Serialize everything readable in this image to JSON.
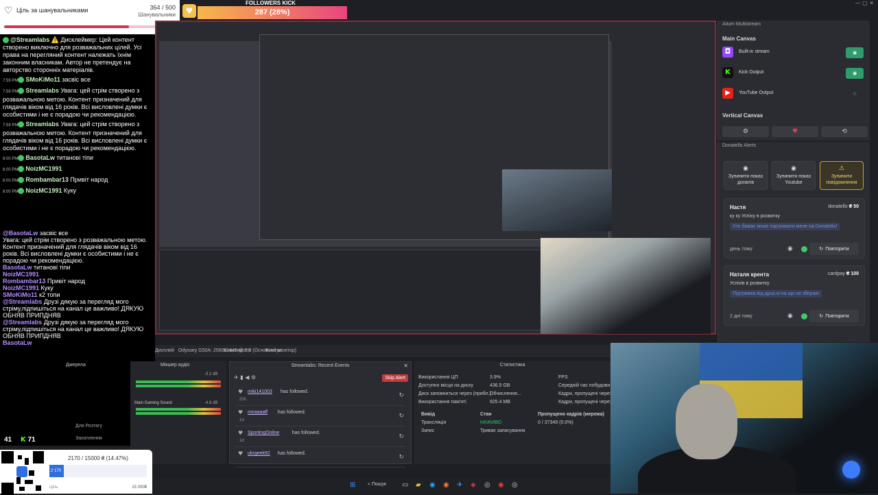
{
  "follower_goal": {
    "title": "Ціль за шанувальниками",
    "count": "364 / 500",
    "subtitle": "Шанувальники",
    "progress": 0.728
  },
  "kick_goal": {
    "label": "FOLLOWERS KICK",
    "value": "287 (28%)",
    "progress": 0.287
  },
  "chat": [
    {
      "time": "",
      "user": "@Streamlabs",
      "text": "⚠️ Дисклеймер: Цей контент створено виключно для розважальних цілей. Усі права на перегляний контент належать їхнім законним власникам. Автор не претендує на авторство сторонніх матеріалів."
    },
    {
      "time": "7:59 PM",
      "user": "SMoKiMo11",
      "text": "засвіс все"
    },
    {
      "time": "7:59 PM",
      "user": "Streamlabs",
      "text": "Увага: цей стрім створено з розважальною метою. Контент призначений для глядачів віком від 16 років. Всі висловлені думки є особистими і не є порадою чи рекомендацією."
    },
    {
      "time": "7:59 PM",
      "user": "Streamlabs",
      "text": "Увага: цей стрім створено з розважальною метою. Контент призначений для глядачів віком від 16 років. Всі висловлені думки є особистими і не є порадою чи рекомендацією."
    },
    {
      "time": "8:00 PM",
      "user": "BasotaLw",
      "text": "титанові тіпи"
    },
    {
      "time": "8:00 PM",
      "user": "NoizMC1991",
      "text": ""
    },
    {
      "time": "8:00 PM",
      "user": "Rombambar13",
      "text": "Привіт народ"
    },
    {
      "time": "8:00 PM",
      "user": "NoizMC1991",
      "text": "Кукy"
    }
  ],
  "chat_overlay": [
    {
      "user": "@BasotaLw",
      "text": "засвіс все"
    },
    {
      "user": "",
      "text": "Увага: цей стрім створено з розважальною метою. Контент призначений для глядачів віком від 16 років. Всі висловлені думки є особистими і не є порадою чи рекомендацією."
    },
    {
      "user": "BasotaLw",
      "text": "титанові тіпи"
    },
    {
      "user": "NoizMC1991",
      "text": ""
    },
    {
      "user": "Rombambar13",
      "text": "Привіт народ"
    },
    {
      "user": "NoizMC1991",
      "text": "Кукy"
    },
    {
      "user": "SMoKiMo11",
      "text": "к2 топи"
    },
    {
      "user": "@Streamlabs",
      "text": "Друзі дякую за перегляд мого стріму,підпишіться на канал це важливо! ДЯКУЮ ОБНЯВ ПРИПДНЯВ"
    },
    {
      "user": "@Streamlabs",
      "text": "Друзі дякую за перегляд мого стріму,підпишіться на канал це важливо! ДЯКУЮ ОБНЯВ ПРИПДНЯВ"
    },
    {
      "user": "BasotaLw",
      "text": ""
    }
  ],
  "viewer_counts": {
    "twitch": "41",
    "kick": "71"
  },
  "aitum": {
    "panel_title": "Aitum Multistream",
    "main_canvas": "Main Canvas",
    "outputs": [
      {
        "name": "Built-in stream",
        "icon": "twitch-icon",
        "state": "on"
      },
      {
        "name": "Kick Output",
        "icon": "kick-icon",
        "state": "on"
      },
      {
        "name": "YouTube Output",
        "icon": "youtube-icon",
        "state": "off"
      }
    ],
    "vertical_canvas": "Vertical Canvas"
  },
  "donatello": {
    "panel_title": "Donatello Alerts",
    "buttons": [
      {
        "label": "Зупинити показ донатів",
        "icon": "stop-icon"
      },
      {
        "label": "Зупинити показ Youtube",
        "icon": "stop-icon"
      },
      {
        "label": "Зупинити повідомлення",
        "icon": "warning-icon"
      }
    ],
    "cards": [
      {
        "name": "Настя",
        "source": "donatello",
        "amount": "₴ 50",
        "message": "ку ку Успіху в розвитку",
        "highlight": "Хто бажає може підтримати мене на Donatello!",
        "when": "день тому",
        "replay": "Повторити"
      },
      {
        "name": "Наталя крента",
        "source": "cardpay",
        "amount": "₴ 100",
        "message": "Успіхів в розвитку",
        "highlight": "Підтримка від душі,ні на що не збераю",
        "when": "2 дні тому",
        "replay": "Повторити"
      }
    ]
  },
  "obs_bar": {
    "properties": "Властивості",
    "filters": "Фільтри",
    "display": "Дисплей",
    "display_value": "Odyssey G50A: 2560x1440 @ 0,0 (Основний монітор)"
  },
  "sources": {
    "header": "Джерела",
    "items": [
      "Для Розтягу",
      "Захоплення"
    ]
  },
  "mixer": {
    "header": "Мікшер аудіо",
    "channels": [
      {
        "name": "",
        "db": "-3.2 dB"
      },
      {
        "name": "Main Gaming Sound",
        "db": "-4.6 dB"
      }
    ]
  },
  "events": {
    "header": "Streamlabs: Recent Events",
    "skip": "Skip Alert",
    "list": [
      {
        "name": "miki141003",
        "action": "has followed.",
        "time": "20h"
      },
      {
        "name": "miraaaaff",
        "action": "has followed.",
        "time": "1d"
      },
      {
        "name": "SportingOnline",
        "action": "has followed.",
        "time": "1d"
      },
      {
        "name": "ukrgeek92",
        "action": "has followed.",
        "time": ""
      }
    ]
  },
  "stats": {
    "header": "Статистика",
    "rows": [
      {
        "label": "Використання ЦП",
        "value": "3.9%",
        "label2": "FPS"
      },
      {
        "label": "Доступно місця на диску",
        "value": "436.5 GB",
        "label2": "Середній час побудови кадру"
      },
      {
        "label": "Диск заповниться через (прибл.)",
        "value": "Обчислення...",
        "label2": "Кадри, пропущені через"
      },
      {
        "label": "Використання пам'яті",
        "value": "925.4 MB",
        "label2": "Кадри, пропущені через"
      }
    ],
    "table_headers": [
      "Вивід",
      "Стан",
      "Пропущено кадрів (мережа)"
    ],
    "table_rows": [
      [
        "Трансляція",
        "НАЖИВО",
        "0 / 37349 (0.0%)"
      ],
      [
        "Запис",
        "Триває записування",
        ""
      ]
    ]
  },
  "donation_goal": {
    "title": "2170 / 15000 ₴ (14.47%)",
    "current": "2 170",
    "min": "Ціль",
    "max": "15 000₴",
    "progress": 0.1447
  },
  "taskbar": {
    "search": "Пошук"
  }
}
